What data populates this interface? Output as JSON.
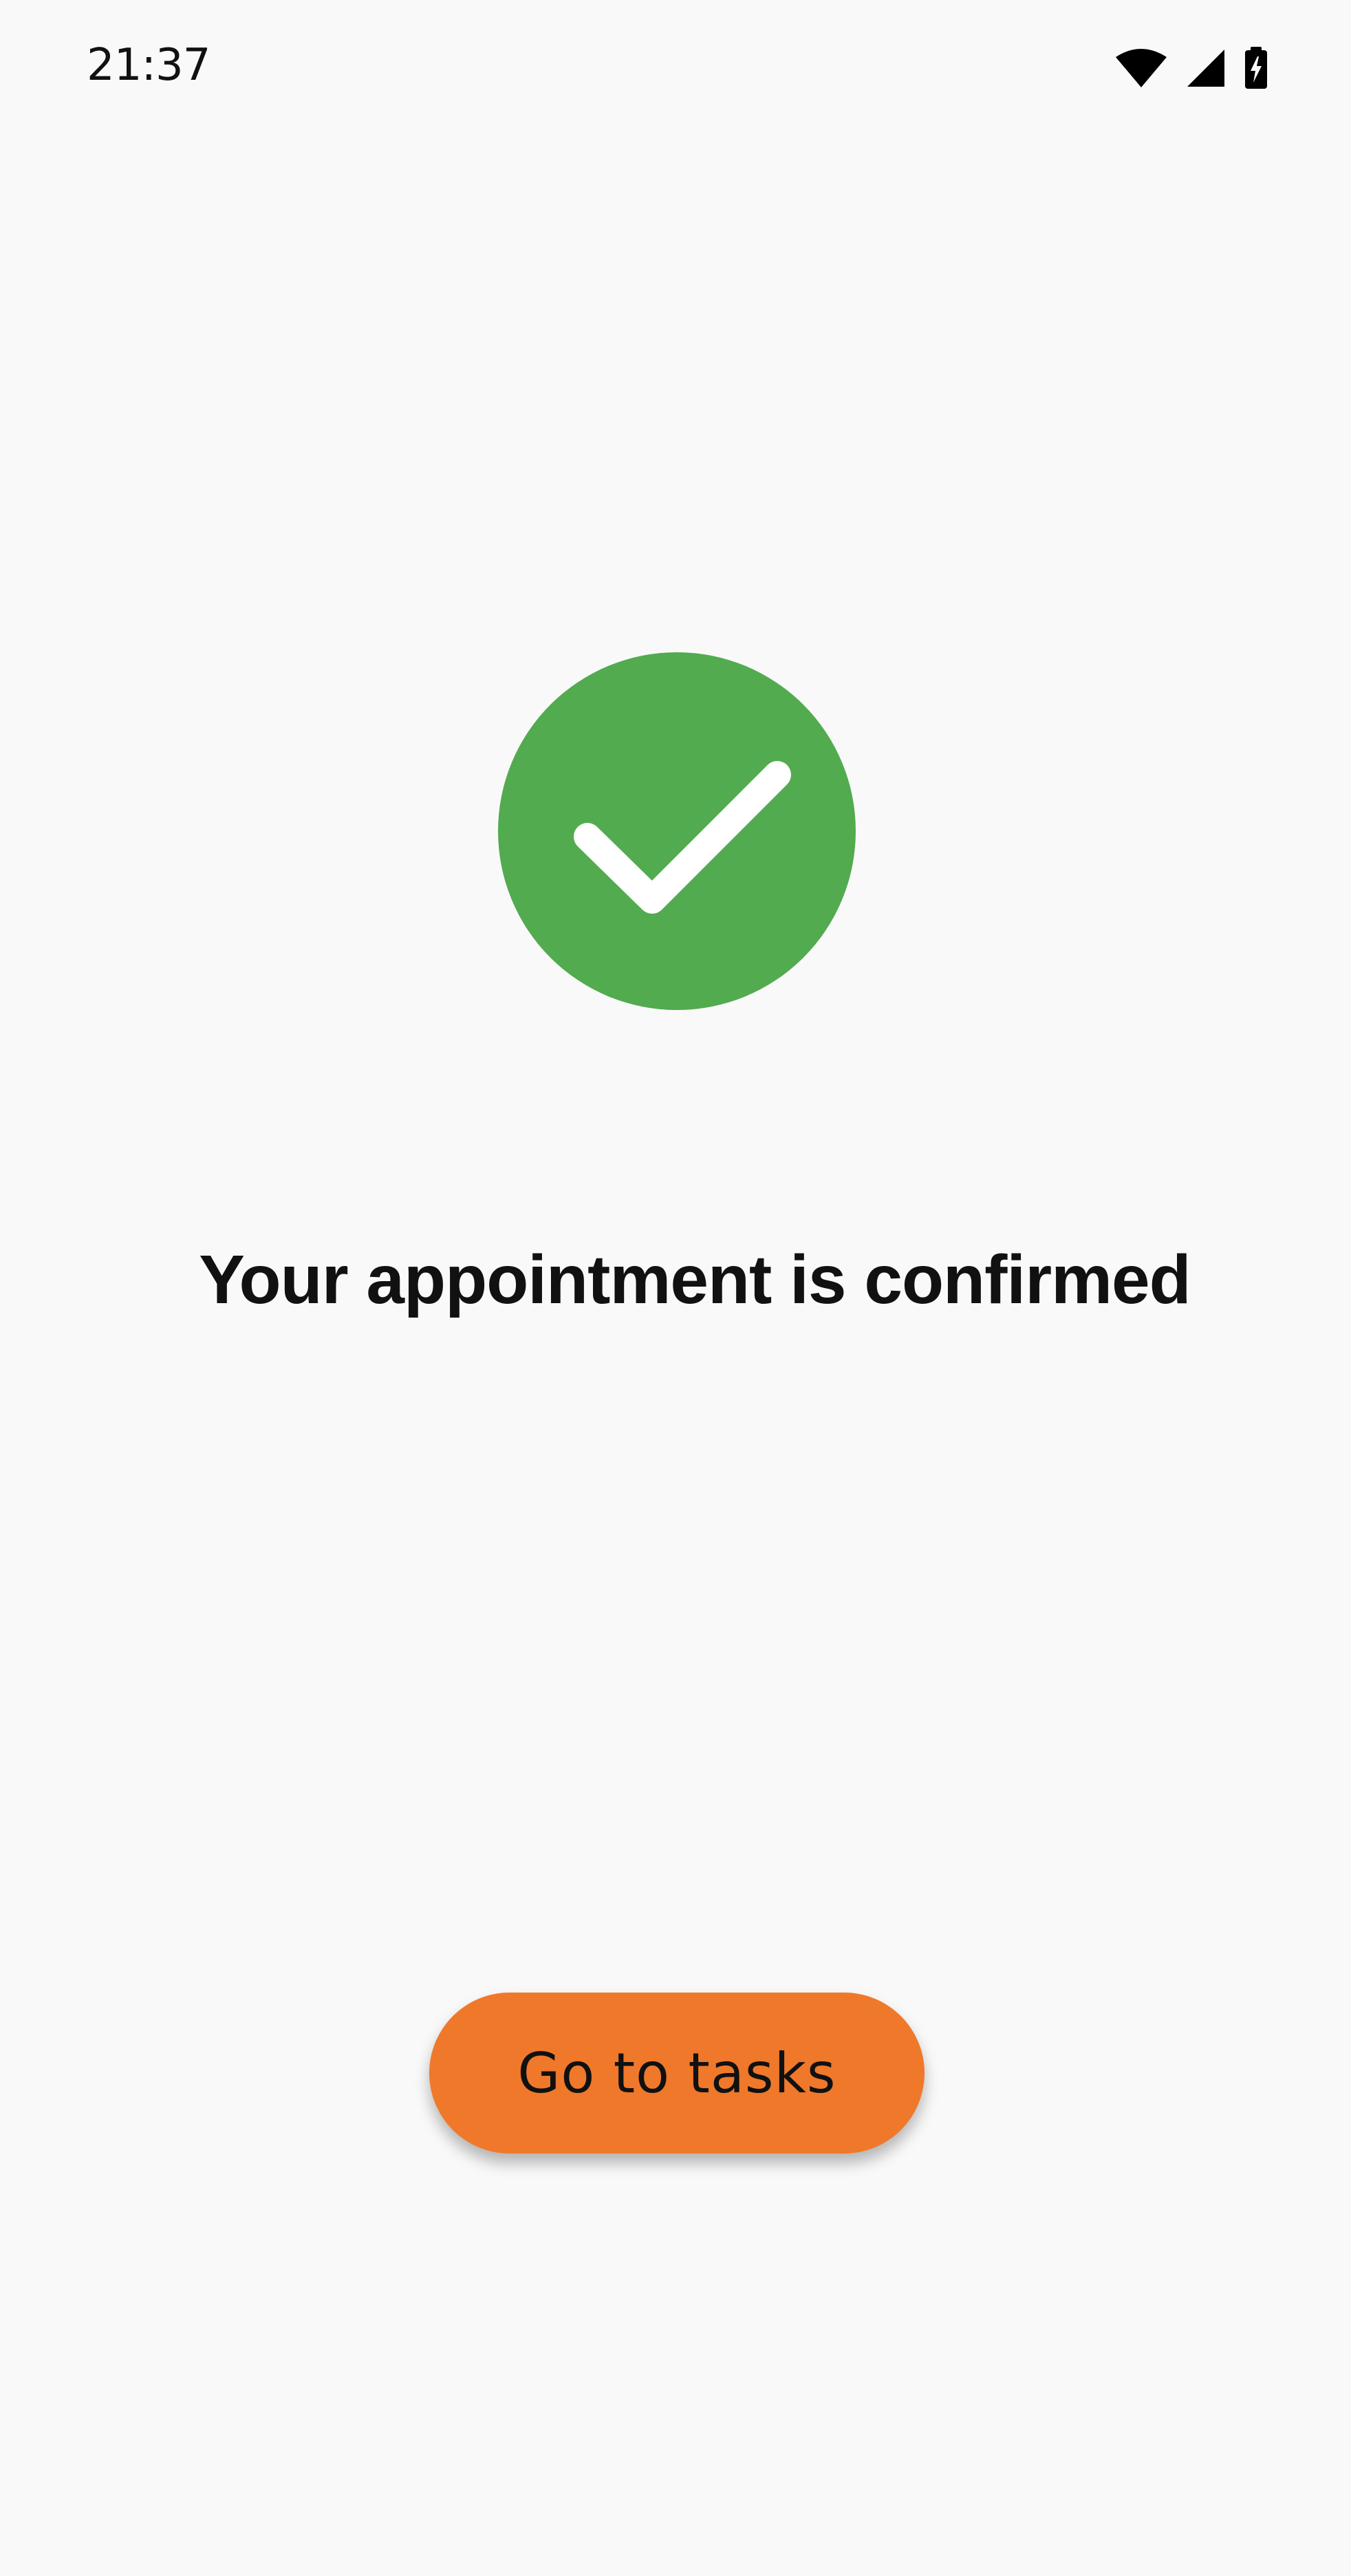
{
  "status_bar": {
    "time": "21:37",
    "icons": [
      "wifi-icon",
      "cellular-signal-icon",
      "battery-charging-icon"
    ]
  },
  "confirmation": {
    "icon": "check-circle-icon",
    "icon_color": "#52ab4f",
    "title": "Your appointment is confirmed"
  },
  "actions": {
    "go_to_tasks_label": "Go to tasks",
    "button_color": "#f0782b"
  }
}
